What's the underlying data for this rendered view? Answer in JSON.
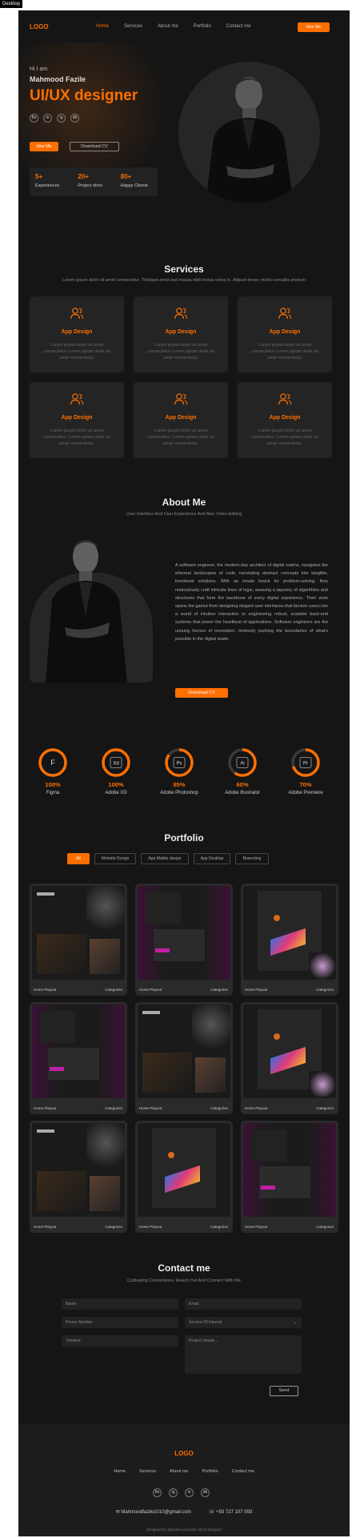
{
  "badge": "Desktop",
  "header": {
    "logo": "LOGO",
    "nav": [
      "Home",
      "Services",
      "About me",
      "Portfolio",
      "Contact me"
    ],
    "hire_button": "Hire Me"
  },
  "hero": {
    "greeting": "Hi I am",
    "name": "Mahmood Fazile",
    "role": "UI/UX designer",
    "socials": [
      "Be",
      "in",
      "Ig",
      "db"
    ],
    "hire_button": "Hire Me",
    "cv_button": "Download CV",
    "stats": [
      {
        "value": "5+",
        "label": "Experiences"
      },
      {
        "value": "20+",
        "label": "Project done"
      },
      {
        "value": "80+",
        "label": "Happy Clients"
      }
    ]
  },
  "services": {
    "title": "Services",
    "subtitle": "Lorem ipsum dolor sit amet consectetur. Tristique amet sed massa nibh lectus netus in. Aliquet donec morbi convallis pretium",
    "items": [
      {
        "title": "App Design",
        "desc": "Lorem ipsum dolor sit amet consectetur. Lorem ipsum dolor sit amet consectetur."
      },
      {
        "title": "App Design",
        "desc": "Lorem ipsum dolor sit amet consectetur. Lorem ipsum dolor sit amet consectetur."
      },
      {
        "title": "App Design",
        "desc": "Lorem ipsum dolor sit amet consectetur. Lorem ipsum dolor sit amet consectetur."
      },
      {
        "title": "App Design",
        "desc": "Lorem ipsum dolor sit amet consectetur. Lorem ipsum dolor sit amet consectetur."
      },
      {
        "title": "App Design",
        "desc": "Lorem ipsum dolor sit amet consectetur. Lorem ipsum dolor sit amet consectetur."
      },
      {
        "title": "App Design",
        "desc": "Lorem ipsum dolor sit amet consectetur. Lorem ipsum dolor sit amet consectetur."
      }
    ]
  },
  "about": {
    "title": "About Me",
    "subtitle": "User Interface And User Experience And Also Video Editing",
    "text": "A software engineer, the modern-day architect of digital realms, navigates the ethereal landscapes of code, translating abstract concepts into tangible, functional solutions. With an innate knack for problem-solving, they meticulously craft intricate lines of logic, weaving a tapestry of algorithms and structures that form the backbone of every digital experience. Their work spans the gamut from designing elegant user interfaces that beckon users into a world of intuitive interaction to engineering robust, scalable back-end systems that power the heartbeat of applications. Software engineers are the unsung heroes of innovation, tirelessly pushing the boundaries of what's possible in the digital realm.",
    "button": "Download CV"
  },
  "skills": [
    {
      "percent": "100%",
      "label": "Figma",
      "icon": "F",
      "value": 1.0
    },
    {
      "percent": "100%",
      "label": "Adobe XD",
      "icon": "Xd",
      "value": 1.0
    },
    {
      "percent": "85%",
      "label": "Adobe Photoshop",
      "icon": "Ps",
      "value": 0.85
    },
    {
      "percent": "60%",
      "label": "Adobe Illustrator",
      "icon": "Ai",
      "value": 0.6
    },
    {
      "percent": "70%",
      "label": "Adobe Premiere",
      "icon": "Pr",
      "value": 0.7
    }
  ],
  "portfolio": {
    "title": "Portfolio",
    "tabs": [
      "All",
      "Website Design",
      "App Mobile design",
      "App Desktop",
      "Braending"
    ],
    "items": [
      {
        "caption": "Home Playout",
        "category": "Categories"
      },
      {
        "caption": "Home Playout",
        "category": "Categories"
      },
      {
        "caption": "Home Playout",
        "category": "Categories"
      },
      {
        "caption": "Home Playout",
        "category": "Categories"
      },
      {
        "caption": "Home Playout",
        "category": "Categories"
      },
      {
        "caption": "Home Playout",
        "category": "Categories"
      },
      {
        "caption": "Home Playout",
        "category": "Categories"
      },
      {
        "caption": "Home Playout",
        "category": "Categories"
      },
      {
        "caption": "Home Playout",
        "category": "Categories"
      }
    ]
  },
  "contact": {
    "title": "Contact me",
    "subtitle": "Cultivating Connections: Reach Out And Connect With Me",
    "name_placeholder": "Name",
    "email_placeholder": "Email",
    "phone_placeholder": "Phone Number",
    "category_placeholder": "Service Of Interest",
    "timeline_placeholder": "Timeline",
    "details_placeholder": "Project Details...",
    "send_button": "Send"
  },
  "footer": {
    "logo": "LOGO",
    "links": [
      "Home",
      "Services",
      "About me",
      "Portfolio",
      "Contact me"
    ],
    "socials": [
      "Be",
      "Ig",
      "in",
      "db"
    ],
    "email": "Mahmoodfazile1010@gmail.com",
    "phone": "+93 727 107 093",
    "copyright": "Designed by @mahmood.fazile UI/UX designer"
  },
  "colors": {
    "accent": "#fd6f00",
    "background": "#151515",
    "card": "#242424"
  }
}
